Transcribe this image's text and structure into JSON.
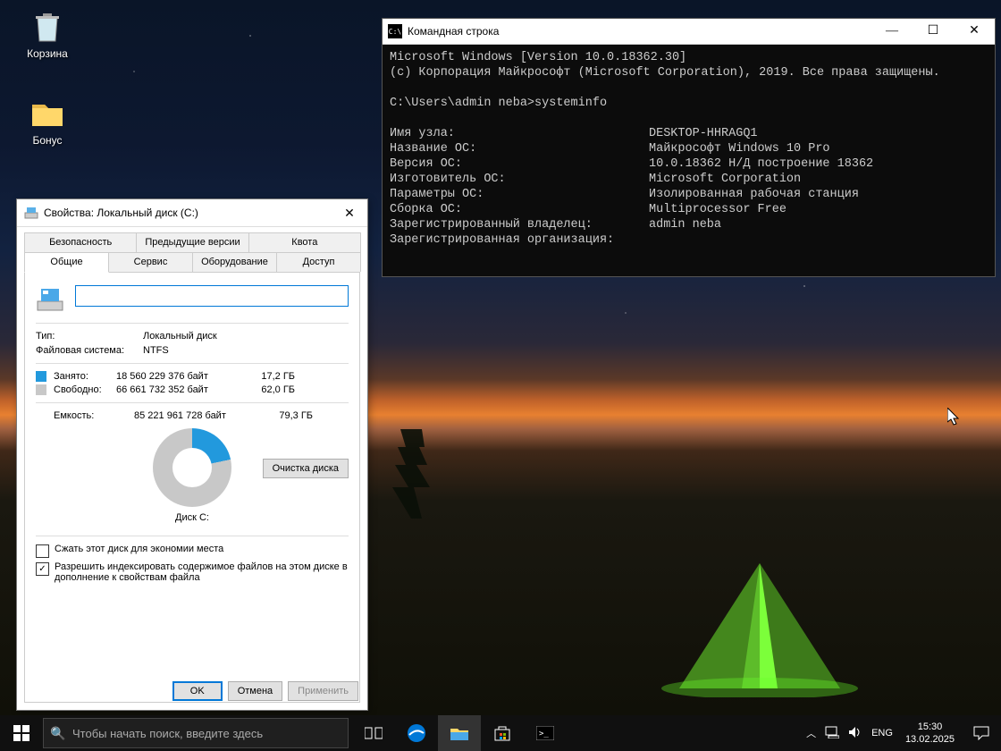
{
  "desktop_icons": {
    "bin": "Корзина",
    "bonus": "Бонус"
  },
  "prop": {
    "title": "Свойства: Локальный диск (C:)",
    "tabs_top": [
      "Безопасность",
      "Предыдущие версии",
      "Квота"
    ],
    "tabs_bot": [
      "Общие",
      "Сервис",
      "Оборудование",
      "Доступ"
    ],
    "name_value": "",
    "type_k": "Тип:",
    "type_v": "Локальный диск",
    "fs_k": "Файловая система:",
    "fs_v": "NTFS",
    "used_k": "Занято:",
    "used_bytes": "18 560 229 376 байт",
    "used_gb": "17,2 ГБ",
    "free_k": "Свободно:",
    "free_bytes": "66 661 732 352 байт",
    "free_gb": "62,0 ГБ",
    "cap_k": "Емкость:",
    "cap_bytes": "85 221 961 728 байт",
    "cap_gb": "79,3 ГБ",
    "disk_label": "Диск C:",
    "cleanup": "Очистка диска",
    "chk1": "Сжать этот диск для экономии места",
    "chk2": "Разрешить индексировать содержимое файлов на этом диске в дополнение к свойствам файла",
    "ok": "OK",
    "cancel": "Отмена",
    "apply": "Применить"
  },
  "cmd": {
    "title": "Командная строка",
    "line1": "Microsoft Windows [Version 10.0.18362.30]",
    "line2": "(c) Корпорация Майкрософт (Microsoft Corporation), 2019. Все права защищены.",
    "prompt": "C:\\Users\\admin neba>systeminfo",
    "rows": [
      {
        "k": "Имя узла:",
        "v": "DESKTOP-HHRAGQ1"
      },
      {
        "k": "Название ОС:",
        "v": "Майкрософт Windows 10 Pro"
      },
      {
        "k": "Версия ОС:",
        "v": "10.0.18362 Н/Д построение 18362"
      },
      {
        "k": "Изготовитель ОС:",
        "v": "Microsoft Corporation"
      },
      {
        "k": "Параметры ОС:",
        "v": "Изолированная рабочая станция"
      },
      {
        "k": "Сборка ОС:",
        "v": "Multiprocessor Free"
      },
      {
        "k": "Зарегистрированный владелец:",
        "v": "admin neba"
      },
      {
        "k": "Зарегистрированная организация:",
        "v": ""
      }
    ]
  },
  "taskbar": {
    "search_placeholder": "Чтобы начать поиск, введите здесь",
    "lang": "ENG",
    "time": "15:30",
    "date": "13.02.2025"
  }
}
